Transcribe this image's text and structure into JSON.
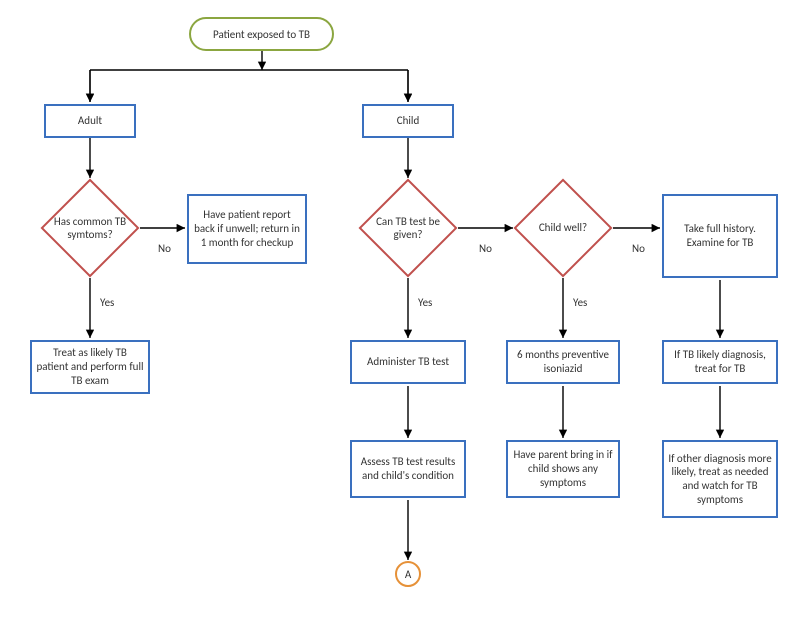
{
  "chart_data": {
    "type": "flowchart",
    "nodes": [
      {
        "id": "start",
        "type": "terminator",
        "label": "Patient exposed to TB"
      },
      {
        "id": "adult",
        "type": "process",
        "label": "Adult"
      },
      {
        "id": "child",
        "type": "process",
        "label": "Child"
      },
      {
        "id": "d_sym",
        "type": "decision",
        "label": "Has common TB symtoms?"
      },
      {
        "id": "report",
        "type": "process",
        "label": "Have patient report back if unwell; return in 1 month for checkup"
      },
      {
        "id": "treat",
        "type": "process",
        "label": "Treat as likely TB patient and perform full TB exam"
      },
      {
        "id": "d_test",
        "type": "decision",
        "label": "Can TB test be given?"
      },
      {
        "id": "admin",
        "type": "process",
        "label": "Administer TB test"
      },
      {
        "id": "assess",
        "type": "process",
        "label": "Assess TB test results and child's condition"
      },
      {
        "id": "d_well",
        "type": "decision",
        "label": "Child well?"
      },
      {
        "id": "isonia",
        "type": "process",
        "label": "6 months preventive isoniazid"
      },
      {
        "id": "parent",
        "type": "process",
        "label": "Have parent bring in if child shows any symptoms"
      },
      {
        "id": "history",
        "type": "process",
        "label": "Take full history. Examine for TB"
      },
      {
        "id": "iftb",
        "type": "process",
        "label": "If TB likely diagnosis, treat for TB"
      },
      {
        "id": "other",
        "type": "process",
        "label": "If other diagnosis more likely, treat as needed and watch for TB symptoms"
      },
      {
        "id": "A",
        "type": "connector",
        "label": "A"
      }
    ],
    "edges": [
      {
        "from": "start",
        "to": "adult"
      },
      {
        "from": "start",
        "to": "child"
      },
      {
        "from": "adult",
        "to": "d_sym"
      },
      {
        "from": "d_sym",
        "to": "treat",
        "label": "Yes"
      },
      {
        "from": "d_sym",
        "to": "report",
        "label": "No"
      },
      {
        "from": "child",
        "to": "d_test"
      },
      {
        "from": "d_test",
        "to": "admin",
        "label": "Yes"
      },
      {
        "from": "d_test",
        "to": "d_well",
        "label": "No"
      },
      {
        "from": "admin",
        "to": "assess"
      },
      {
        "from": "assess",
        "to": "A"
      },
      {
        "from": "d_well",
        "to": "isonia",
        "label": "Yes"
      },
      {
        "from": "d_well",
        "to": "history",
        "label": "No"
      },
      {
        "from": "isonia",
        "to": "parent"
      },
      {
        "from": "history",
        "to": "iftb"
      },
      {
        "from": "iftb",
        "to": "other"
      }
    ]
  },
  "nodes": {
    "start": "Patient exposed to TB",
    "adult": "Adult",
    "child": "Child",
    "d_sym": "Has common TB symtoms?",
    "report": "Have patient report back if unwell; return in 1 month for checkup",
    "treat": "Treat as likely TB patient and perform full TB exam",
    "d_test": "Can TB test be given?",
    "admin": "Administer TB test",
    "assess": "Assess TB test results and child's condition",
    "d_well": "Child well?",
    "isonia": "6 months preventive isoniazid",
    "parent": "Have parent bring in if child shows any symptoms",
    "history": "Take full history. Examine for TB",
    "iftb": "If TB likely diagnosis, treat for TB",
    "other": "If other diagnosis more likely, treat as needed and watch for TB symptoms",
    "A": "A"
  },
  "labels": {
    "yes": "Yes",
    "no": "No"
  }
}
